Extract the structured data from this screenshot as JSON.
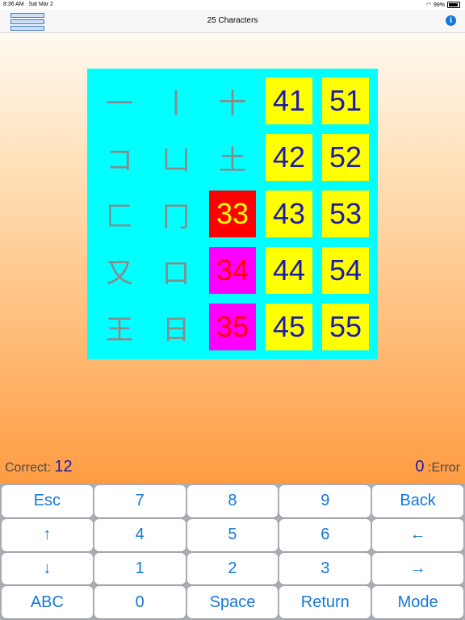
{
  "status": {
    "time": "8:36 AM",
    "date": "Sat Mar 2",
    "battery": "99%"
  },
  "header": {
    "title": "25 Characters"
  },
  "board": {
    "cells": [
      {
        "text": "一",
        "style": "plain",
        "col": 0,
        "row": 0
      },
      {
        "text": "丨",
        "style": "plain",
        "col": 1,
        "row": 0
      },
      {
        "text": "十",
        "style": "plain",
        "col": 2,
        "row": 0
      },
      {
        "text": "41",
        "style": "yellow",
        "col": 3,
        "row": 0
      },
      {
        "text": "51",
        "style": "yellow",
        "col": 4,
        "row": 0
      },
      {
        "text": "コ",
        "style": "plain",
        "col": 0,
        "row": 1
      },
      {
        "text": "凵",
        "style": "plain",
        "col": 1,
        "row": 1
      },
      {
        "text": "土",
        "style": "plain",
        "col": 2,
        "row": 1
      },
      {
        "text": "42",
        "style": "yellow",
        "col": 3,
        "row": 1
      },
      {
        "text": "52",
        "style": "yellow",
        "col": 4,
        "row": 1
      },
      {
        "text": "匚",
        "style": "plain",
        "col": 0,
        "row": 2
      },
      {
        "text": "冂",
        "style": "plain",
        "col": 1,
        "row": 2
      },
      {
        "text": "33",
        "style": "red",
        "col": 2,
        "row": 2
      },
      {
        "text": "43",
        "style": "yellow",
        "col": 3,
        "row": 2
      },
      {
        "text": "53",
        "style": "yellow",
        "col": 4,
        "row": 2
      },
      {
        "text": "又",
        "style": "plain",
        "col": 0,
        "row": 3
      },
      {
        "text": "口",
        "style": "plain",
        "col": 1,
        "row": 3
      },
      {
        "text": "34",
        "style": "magenta",
        "col": 2,
        "row": 3
      },
      {
        "text": "44",
        "style": "yellow",
        "col": 3,
        "row": 3
      },
      {
        "text": "54",
        "style": "yellow",
        "col": 4,
        "row": 3
      },
      {
        "text": "王",
        "style": "plain",
        "col": 0,
        "row": 4
      },
      {
        "text": "日",
        "style": "plain",
        "col": 1,
        "row": 4
      },
      {
        "text": "35",
        "style": "magenta",
        "col": 2,
        "row": 4
      },
      {
        "text": "45",
        "style": "yellow",
        "col": 3,
        "row": 4
      },
      {
        "text": "55",
        "style": "yellow",
        "col": 4,
        "row": 4
      }
    ]
  },
  "score": {
    "correct_label": "Correct:",
    "correct_value": "12",
    "error_value": "0",
    "error_label": ":Error"
  },
  "keyboard": {
    "keys": [
      "Esc",
      "7",
      "8",
      "9",
      "Back",
      "↑",
      "4",
      "5",
      "6",
      "←",
      "↓",
      "1",
      "2",
      "3",
      "→",
      "ABC",
      "0",
      "Space",
      "Return",
      "Mode"
    ]
  },
  "colors": {
    "board": "#00ffff",
    "yellow": "#ffff00",
    "red": "#ff0000",
    "magenta": "#ff00ff",
    "key_text": "#1478d8"
  }
}
